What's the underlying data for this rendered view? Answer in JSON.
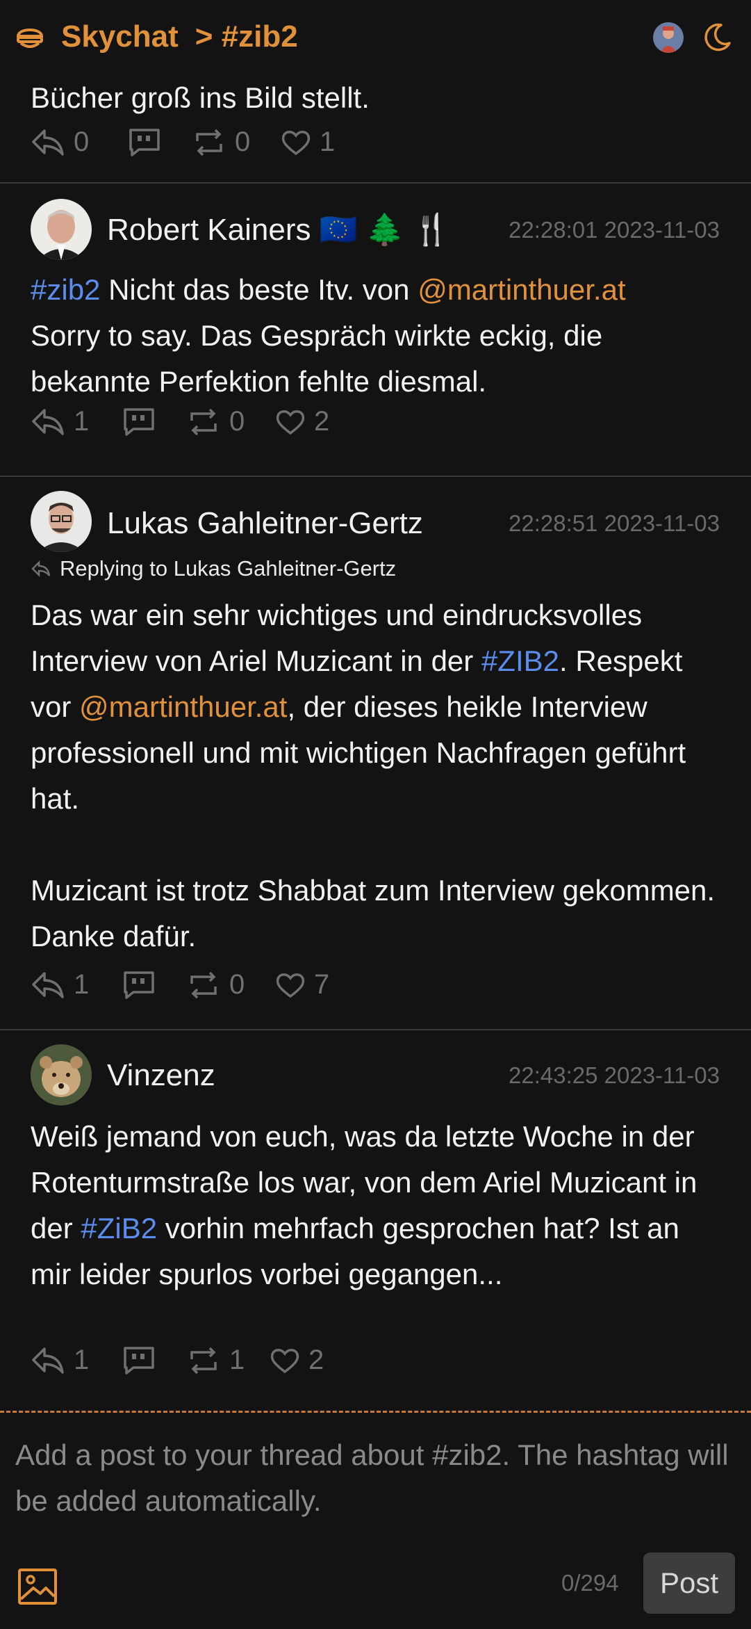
{
  "header": {
    "app_name": "Skychat",
    "separator": ">",
    "channel": "#zib2"
  },
  "posts": [
    {
      "text_lines": [
        "Bücher groß ins Bild stellt."
      ],
      "replies": "0",
      "quotes": "",
      "reposts": "0",
      "likes": "1"
    },
    {
      "author": "Robert Kainers 🇪🇺 🌲 🍴",
      "time": "22:28:01 2023-11-03",
      "hashtag": "#zib2",
      "text_a": " Nicht das beste Itv. von ",
      "mention": "@martinthuer.at",
      "text_b": "Sorry to say. Das Gespräch wirkte eckig, die bekannte Perfektion fehlte diesmal.",
      "replies": "1",
      "reposts": "0",
      "likes": "2"
    },
    {
      "author": "Lukas Gahleitner-Gertz",
      "time": "22:28:51 2023-11-03",
      "reply_to": "Replying to Lukas Gahleitner-Gertz",
      "text_a": "Das war ein sehr wichtiges und eindrucksvolles Interview von Ariel Muzicant in der ",
      "hashtag": "#ZIB2",
      "text_b": ". Respekt vor ",
      "mention": "@martinthuer.at",
      "text_c": ", der dieses heikle Interview professionell und mit wichtigen Nachfragen geführt hat.",
      "text_d": "Muzicant ist trotz Shabbat zum Interview gekommen. Danke dafür.",
      "replies": "1",
      "reposts": "0",
      "likes": "7"
    },
    {
      "author": "Vinzenz",
      "time": "22:43:25 2023-11-03",
      "text_a": "Weiß jemand von euch, was da letzte Woche in der Rotenturmstraße los war, von dem Ariel Muzicant in der ",
      "hashtag": "#ZiB2",
      "text_b": " vorhin mehrfach gesprochen hat? Ist an mir leider spurlos vorbei gegangen...",
      "replies": "1",
      "reposts": "1",
      "likes": "2"
    }
  ],
  "composer": {
    "placeholder": "Add a post to your thread about #zib2. The hashtag will be added automatically.",
    "counter": "0/294",
    "post_label": "Post"
  },
  "colors": {
    "accent": "#e0913a",
    "hashtag": "#5b8def",
    "background": "#131313"
  }
}
